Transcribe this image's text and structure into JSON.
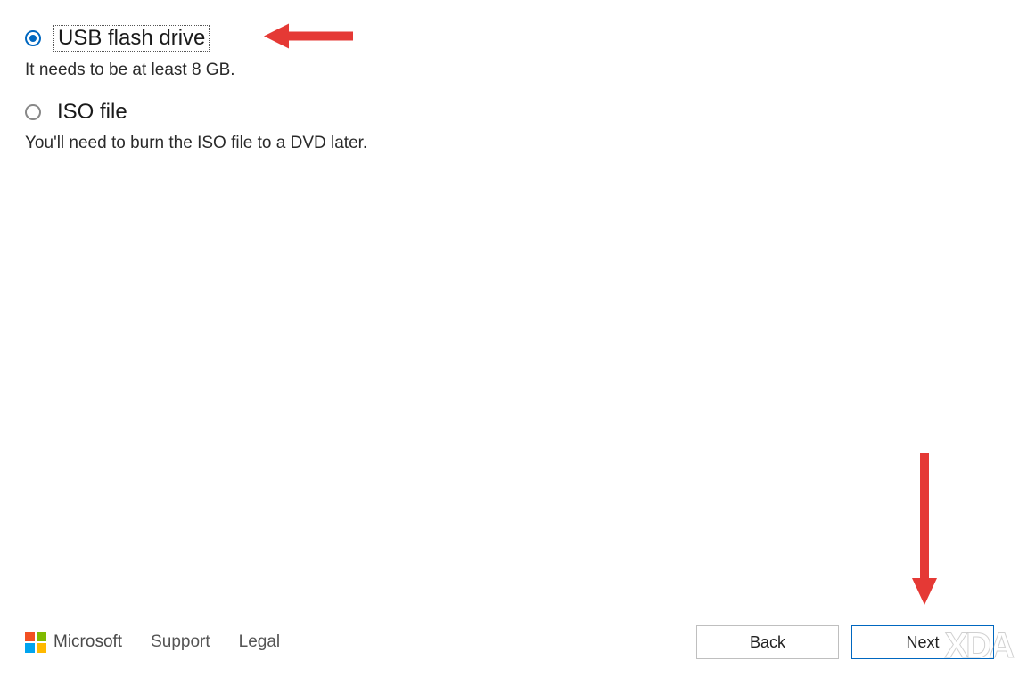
{
  "options": [
    {
      "label": "USB flash drive",
      "description": "It needs to be at least 8 GB.",
      "selected": true
    },
    {
      "label": "ISO file",
      "description": "You'll need to burn the ISO file to a DVD later.",
      "selected": false
    }
  ],
  "footer": {
    "brand": "Microsoft",
    "links": {
      "support": "Support",
      "legal": "Legal"
    },
    "buttons": {
      "back": "Back",
      "next": "Next"
    }
  },
  "watermark": "XDA",
  "annotations": {
    "top_arrow_color": "#e53935",
    "bottom_arrow_color": "#e53935"
  }
}
